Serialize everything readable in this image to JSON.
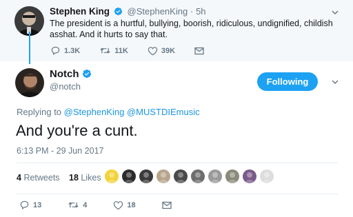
{
  "parent_tweet": {
    "author_name": "Stephen King",
    "handle": "@StephenKing",
    "separator": "·",
    "time": "5h",
    "text": "The president is a hurtful, bullying, boorish, ridiculous, undignified, childish asshat. And it hurts to say that.",
    "actions": {
      "replies": "1.3K",
      "retweets": "11K",
      "likes": "39K"
    }
  },
  "main_tweet": {
    "author_name": "Notch",
    "handle": "@notch",
    "follow_button": "Following",
    "replying_prefix": "Replying to",
    "replying_to": [
      "@StephenKing",
      "@MUSTDIEmusic"
    ],
    "text": "And you're a cunt.",
    "timestamp": "6:13 PM - 29 Jun 2017",
    "stats": {
      "retweets_count": "4",
      "retweets_label": "Retweets",
      "likes_count": "18",
      "likes_label": "Likes"
    },
    "likers": [
      {
        "color": "#f3d33b"
      },
      {
        "color": "#2b2b2b"
      },
      {
        "color": "#3a3a3a"
      },
      {
        "color": "#b8a48c"
      },
      {
        "color": "#4a4a4a"
      },
      {
        "color": "#6d6d6d"
      },
      {
        "color": "#9a9a9a"
      },
      {
        "color": "#8a8a7a"
      },
      {
        "color": "#7a5a8a"
      },
      {
        "color": "#dddddd"
      }
    ],
    "actions": {
      "replies": "13",
      "retweets": "4",
      "likes": "18"
    }
  },
  "colors": {
    "accent": "#1da1f2",
    "link": "#1b95e0",
    "muted": "#657786",
    "parent_bg": "#f5f8fa"
  },
  "icons": [
    "verified-badge",
    "chevron-down",
    "reply",
    "retweet",
    "heart",
    "envelope"
  ]
}
